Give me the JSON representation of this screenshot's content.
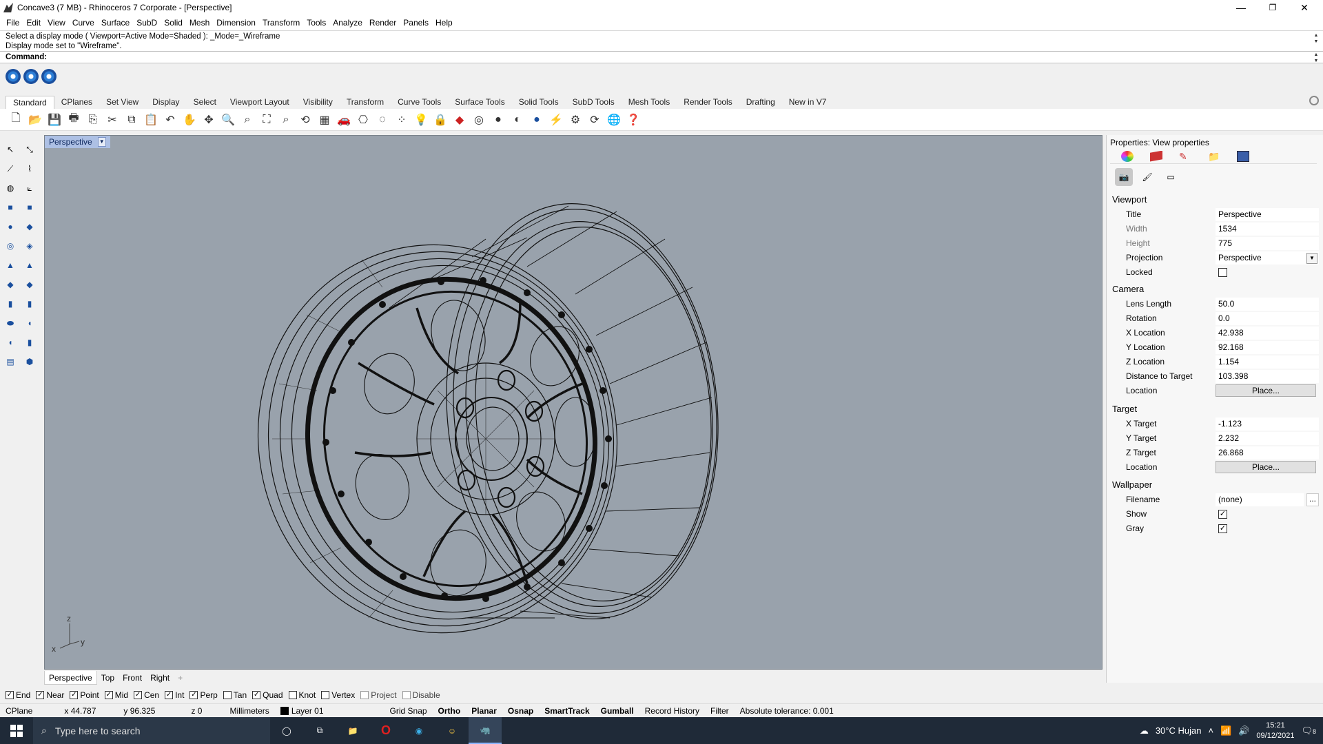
{
  "window": {
    "title": "Concave3 (7 MB) - Rhinoceros 7 Corporate - [Perspective]",
    "controls": [
      "—",
      "❐",
      "✕"
    ]
  },
  "menu": [
    "File",
    "Edit",
    "View",
    "Curve",
    "Surface",
    "SubD",
    "Solid",
    "Mesh",
    "Dimension",
    "Transform",
    "Tools",
    "Analyze",
    "Render",
    "Panels",
    "Help"
  ],
  "command": {
    "history_line1": "Select a display mode ( Viewport=Active  Mode=Shaded ): _Mode=_Wireframe",
    "history_line2": "Display mode set to \"Wireframe\".",
    "prompt": "Command:"
  },
  "toolbar_tabs": [
    "Standard",
    "CPlanes",
    "Set View",
    "Display",
    "Select",
    "Viewport Layout",
    "Visibility",
    "Transform",
    "Curve Tools",
    "Surface Tools",
    "Solid Tools",
    "SubD Tools",
    "Mesh Tools",
    "Render Tools",
    "Drafting",
    "New in V7"
  ],
  "viewport": {
    "title": "Perspective",
    "display_mode": "Wireframe",
    "axis_x": "x",
    "axis_y": "y",
    "axis_z": "z",
    "background": "#99a2ac"
  },
  "viewport_tabs": [
    "Perspective",
    "Top",
    "Front",
    "Right",
    "+"
  ],
  "properties": {
    "panel_title": "Properties: View properties",
    "sections": {
      "viewport": "Viewport",
      "camera": "Camera",
      "target": "Target",
      "wallpaper": "Wallpaper"
    },
    "title_label": "Title",
    "title_value": "Perspective",
    "width_label": "Width",
    "width_value": "1534",
    "height_label": "Height",
    "height_value": "775",
    "projection_label": "Projection",
    "projection_value": "Perspective",
    "locked_label": "Locked",
    "locked": false,
    "lens_label": "Lens Length",
    "lens_value": "50.0",
    "rotation_label": "Rotation",
    "rotation_value": "0.0",
    "xloc_label": "X Location",
    "xloc_value": "42.938",
    "yloc_label": "Y Location",
    "yloc_value": "92.168",
    "zloc_label": "Z Location",
    "zloc_value": "1.154",
    "dist_label": "Distance to Target",
    "dist_value": "103.398",
    "location_label": "Location",
    "place_button": "Place...",
    "xt_label": "X Target",
    "xt_value": "-1.123",
    "yt_label": "Y Target",
    "yt_value": "2.232",
    "zt_label": "Z Target",
    "zt_value": "26.868",
    "filename_label": "Filename",
    "filename_value": "(none)",
    "filename_browse": "...",
    "show_label": "Show",
    "show": true,
    "gray_label": "Gray",
    "gray": true
  },
  "osnap": {
    "items": [
      {
        "label": "End",
        "checked": true
      },
      {
        "label": "Near",
        "checked": true
      },
      {
        "label": "Point",
        "checked": true
      },
      {
        "label": "Mid",
        "checked": true
      },
      {
        "label": "Cen",
        "checked": true
      },
      {
        "label": "Int",
        "checked": true
      },
      {
        "label": "Perp",
        "checked": true
      },
      {
        "label": "Tan",
        "checked": false
      },
      {
        "label": "Quad",
        "checked": true
      },
      {
        "label": "Knot",
        "checked": false
      },
      {
        "label": "Vertex",
        "checked": false
      },
      {
        "label": "Project",
        "checked": false
      },
      {
        "label": "Disable",
        "checked": false
      }
    ]
  },
  "status": {
    "cplane": "CPlane",
    "x": "x 44.787",
    "y": "y 96.325",
    "z": "z 0",
    "units": "Millimeters",
    "layer": "Layer 01",
    "grid_snap": "Grid Snap",
    "ortho": "Ortho",
    "planar": "Planar",
    "osnap": "Osnap",
    "smarttrack": "SmartTrack",
    "gumball": "Gumball",
    "record_history": "Record History",
    "filter": "Filter",
    "tolerance": "Absolute tolerance: 0.001"
  },
  "taskbar": {
    "search_placeholder": "Type here to search",
    "weather": "30°C  Hujan",
    "time": "15:21",
    "date": "09/12/2021",
    "notifications": "8"
  }
}
